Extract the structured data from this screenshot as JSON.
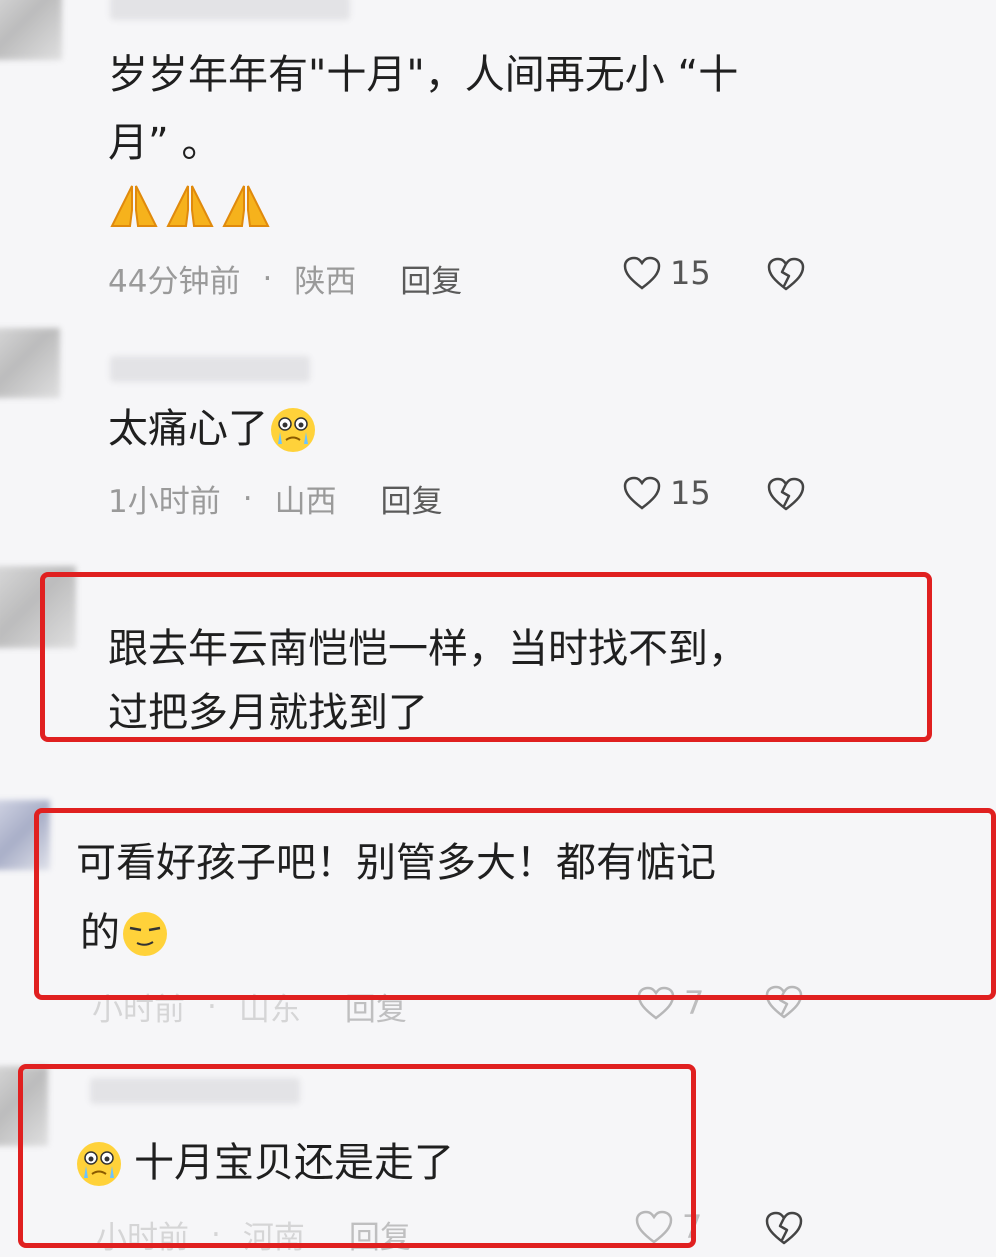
{
  "comments": [
    {
      "text_line1": "岁岁年年有\"十月\"，人间再无小 “十",
      "text_line2": "月” 。",
      "time": "44分钟前",
      "location": "陕西",
      "reply": "回复",
      "likes": "15"
    },
    {
      "text": "太痛心了",
      "time": "1小时前",
      "location": "山西",
      "reply": "回复",
      "likes": "15"
    },
    {
      "text_line1": "跟去年云南恺恺一样，当时找不到，",
      "text_line2": "过把多月就找到了"
    },
    {
      "text_line1": "可看好孩子吧！别管多大！都有惦记",
      "text_line2": "的",
      "time": "小时前",
      "location": "山东",
      "reply": "回复",
      "likes": "7"
    },
    {
      "text": "十月宝贝还是走了",
      "time": "小时前",
      "location": "河南",
      "reply": "回复",
      "likes": "7"
    }
  ],
  "icons": {
    "like": "heart-outline-icon",
    "dislike": "broken-heart-icon",
    "pray": "praying-hands-emoji",
    "crying": "crying-face-emoji",
    "smug": "smug-face-emoji"
  },
  "colors": {
    "highlight_box": "#e02020",
    "meta_text": "#9a9a9a"
  },
  "separator": "·"
}
